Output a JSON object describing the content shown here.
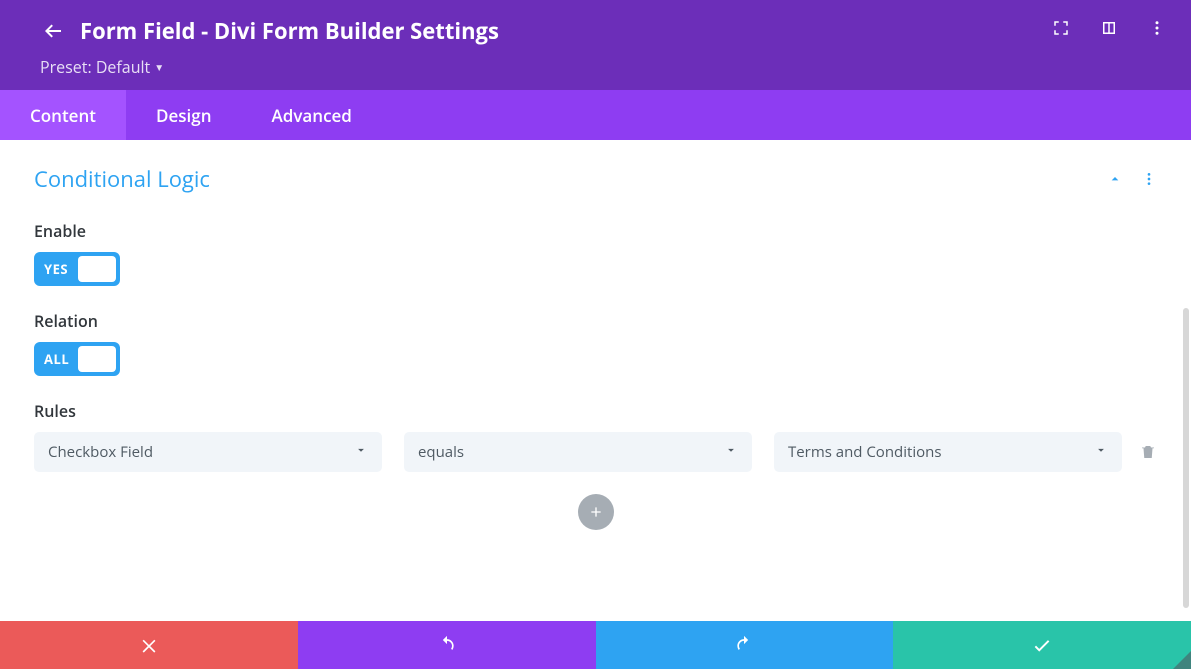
{
  "header": {
    "title": "Form Field - Divi Form Builder Settings",
    "preset": "Preset: Default"
  },
  "tabs": {
    "content": "Content",
    "design": "Design",
    "advanced": "Advanced",
    "active": "content"
  },
  "section": {
    "title": "Conditional Logic",
    "enable_label": "Enable",
    "enable_value": "YES",
    "relation_label": "Relation",
    "relation_value": "ALL",
    "rules_label": "Rules"
  },
  "rule": {
    "field": "Checkbox Field",
    "operator": "equals",
    "value": "Terms and Conditions"
  },
  "next_section_hint": "",
  "icons": {
    "back": "back-arrow",
    "expand": "expand-icon",
    "responsive": "responsive-icon",
    "kebab": "kebab-icon",
    "chevron_up": "chevron-up-icon",
    "trash": "trash-icon",
    "plus": "plus-icon",
    "cancel": "cancel-icon",
    "undo": "undo-icon",
    "redo": "redo-icon",
    "save": "check-icon"
  },
  "colors": {
    "header_purple": "#6c2eb9",
    "tab_purple": "#8e3df2",
    "tab_active": "#a453ff",
    "accent_blue": "#2ea3f2",
    "footer_red": "#eb5a59",
    "footer_green": "#29c4a9",
    "grey_select": "#f1f5f9"
  }
}
